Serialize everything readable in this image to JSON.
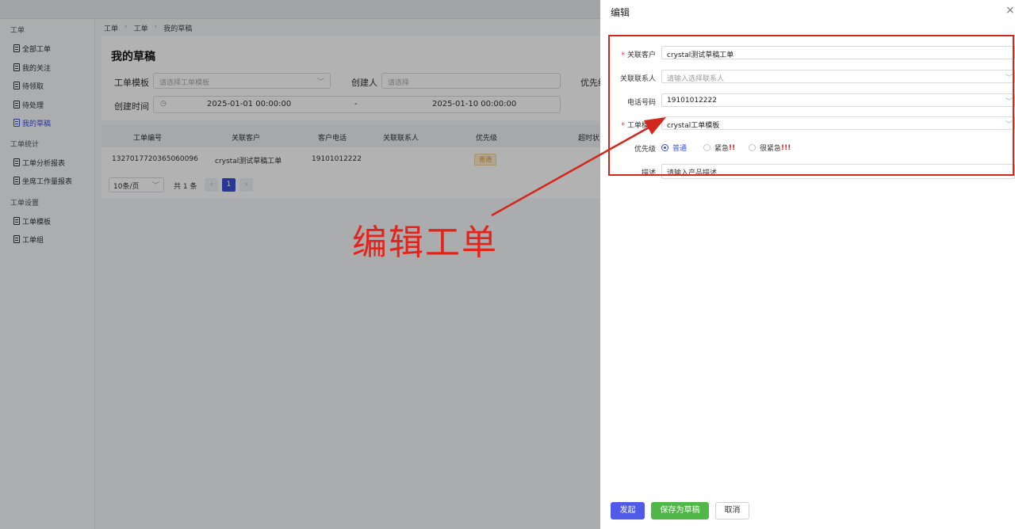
{
  "sidebar": {
    "groups": [
      {
        "label": "工单",
        "items": [
          {
            "label": "全部工单"
          },
          {
            "label": "我的关注"
          },
          {
            "label": "待领取"
          },
          {
            "label": "待处理"
          },
          {
            "label": "我的草稿",
            "active": true
          }
        ]
      },
      {
        "label": "工单统计",
        "items": [
          {
            "label": "工单分析报表"
          },
          {
            "label": "坐席工作量报表"
          }
        ]
      },
      {
        "label": "工单设置",
        "items": [
          {
            "label": "工单模板"
          },
          {
            "label": "工单组"
          }
        ]
      }
    ]
  },
  "breadcrumb": [
    "工单",
    "工单",
    "我的草稿"
  ],
  "page": {
    "title": "我的草稿",
    "filters": {
      "template_label": "工单模板",
      "template_placeholder": "请选择工单模板",
      "creator_label": "创建人",
      "creator_placeholder": "请选择",
      "priority_label": "优先级",
      "created_time_label": "创建时间",
      "date_start": "2025-01-01 00:00:00",
      "date_sep": "-",
      "date_end": "2025-01-10 00:00:00"
    },
    "table": {
      "columns": [
        "工单编号",
        "关联客户",
        "客户电话",
        "关联联系人",
        "优先级",
        "超时状"
      ],
      "rows": [
        {
          "id": "1327017720365060096",
          "customer": "crystal测试草稿工单",
          "phone": "19101012222",
          "contact": "",
          "priority": "普通"
        }
      ]
    },
    "pager": {
      "size": "10条/页",
      "total": "共 1 条",
      "prev": "‹",
      "next": "›",
      "current": "1"
    }
  },
  "drawer": {
    "title": "编辑",
    "close": "×",
    "fields": {
      "customer_label": "关联客户",
      "customer_value": "crystal测试草稿工单",
      "contact_label": "关联联系人",
      "contact_placeholder": "请输入选择联系人",
      "phone_label": "电话号码",
      "phone_value": "19101012222",
      "template_label": "工单模板",
      "template_value": "crystal工单模板",
      "priority_label": "优先级",
      "priority_options": [
        {
          "label": "普通",
          "mark": "",
          "selected": true
        },
        {
          "label": "紧急",
          "mark": "!!",
          "selected": false
        },
        {
          "label": "很紧急",
          "mark": "!!!",
          "selected": false
        }
      ],
      "desc_label": "描述",
      "desc_placeholder": "请输入产品描述"
    },
    "buttons": {
      "submit": "发起",
      "save_draft": "保存为草稿",
      "cancel": "取消"
    }
  },
  "annotation": {
    "text": "编辑工单",
    "color": "#e3241c"
  },
  "colors": {
    "primary": "#3b4fd8",
    "success": "#50b748",
    "highlight": "#d3271b"
  },
  "icons": {
    "dropdown": "chevron-down-icon",
    "clock": "clock-icon",
    "close": "close-icon",
    "doc": "document-icon"
  }
}
